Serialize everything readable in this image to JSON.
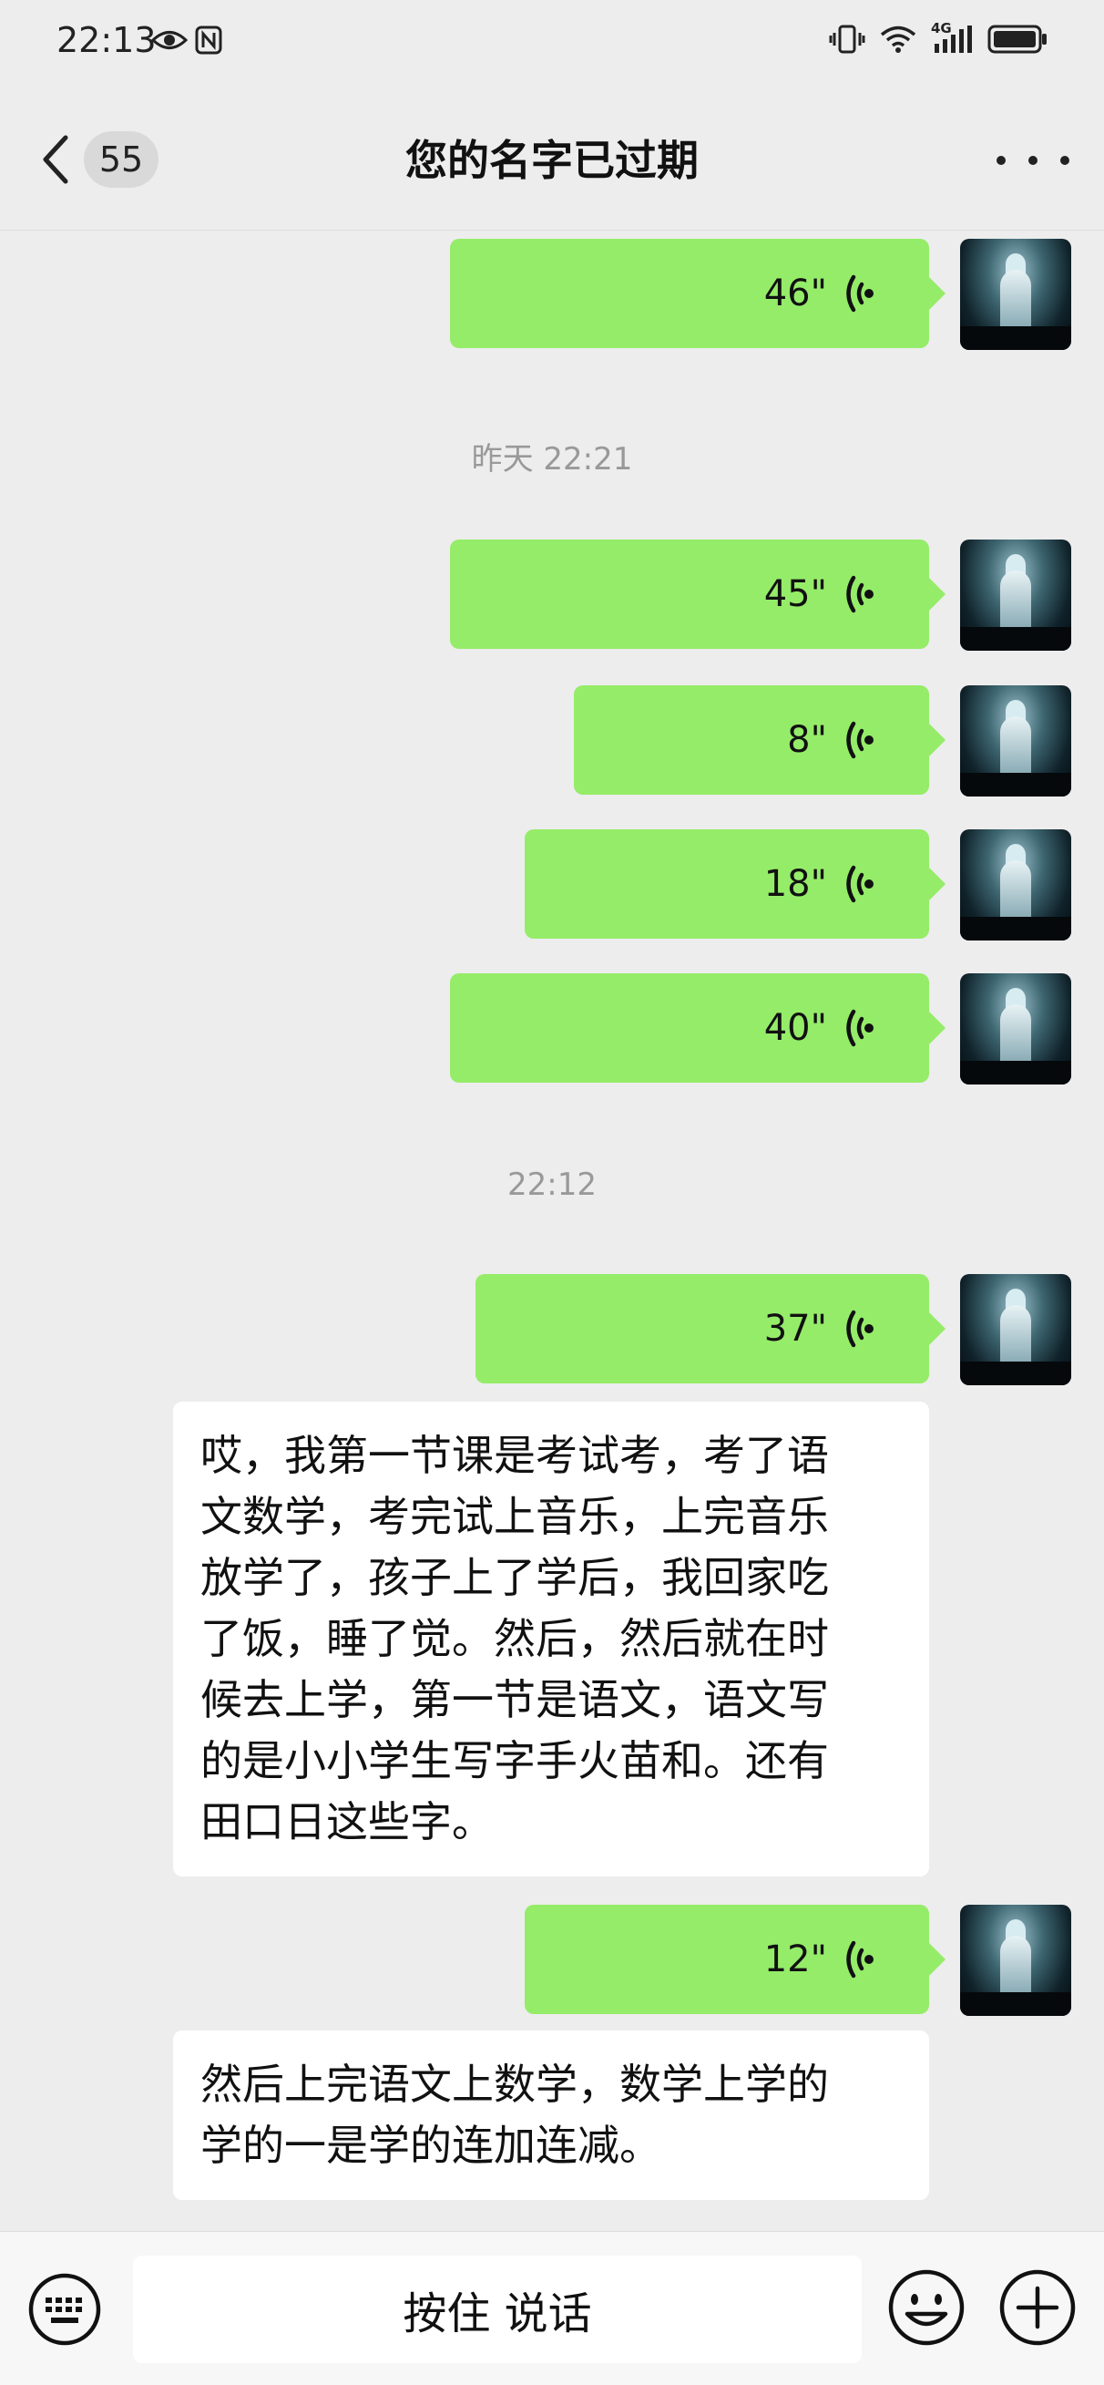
{
  "status_bar": {
    "time": "22:13",
    "left_icons": [
      "eye-icon",
      "nfc-icon"
    ],
    "right_icons": [
      "vibrate-icon",
      "wifi-icon",
      "signal-4g-icon",
      "battery-icon"
    ],
    "network_label": "4G"
  },
  "header": {
    "back_count": "55",
    "title": "您的名字已过期",
    "more_icon": "more-dots-icon"
  },
  "messages": [
    {
      "type": "voice",
      "side": "right",
      "duration": "46\""
    },
    {
      "type": "timestamp",
      "text": "昨天 22:21"
    },
    {
      "type": "voice",
      "side": "right",
      "duration": "45\""
    },
    {
      "type": "voice",
      "side": "right",
      "duration": "8\""
    },
    {
      "type": "voice",
      "side": "right",
      "duration": "18\""
    },
    {
      "type": "voice",
      "side": "right",
      "duration": "40\""
    },
    {
      "type": "timestamp",
      "text": "22:12"
    },
    {
      "type": "voice",
      "side": "right",
      "duration": "37\""
    },
    {
      "type": "text",
      "side": "right-transcript",
      "lines": [
        "哎，我第一节课是考试考，考了语",
        "文数学，考完试上音乐，上完音乐",
        "放学了，孩子上了学后，我回家吃",
        "了饭，睡了觉。然后，然后就在时",
        "候去上学，第一节是语文，语文写",
        "的是小小学生写字手火苗和。还有",
        "田口日这些字。"
      ]
    },
    {
      "type": "voice",
      "side": "right",
      "duration": "12\""
    },
    {
      "type": "text",
      "side": "right-transcript",
      "lines": [
        "然后上完语文上数学，数学上学的",
        "学的一是学的连加连减。"
      ]
    }
  ],
  "input_bar": {
    "hold_to_talk": "按住 说话",
    "left_icon": "keyboard-icon",
    "emoji_icon": "emoji-icon",
    "plus_icon": "plus-icon"
  },
  "colors": {
    "voice_bubble": "#95ec69",
    "background": "#ededed",
    "text_bubble": "#ffffff"
  }
}
